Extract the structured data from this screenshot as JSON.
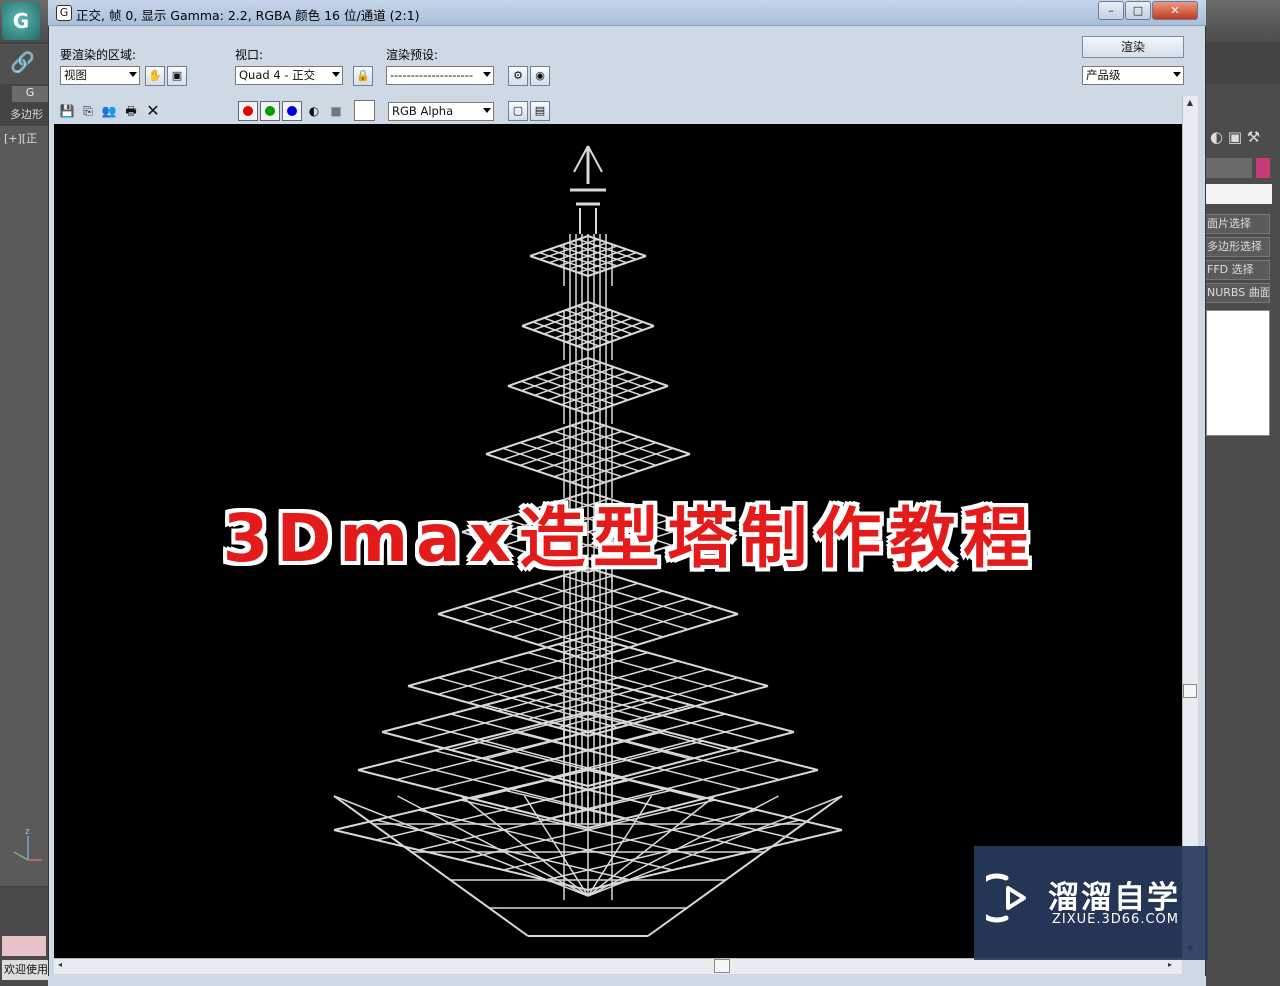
{
  "app": {
    "tab_g": "G",
    "tab_poly": "多边形",
    "viewport_label": "[+][正",
    "welcome": "欢迎使用",
    "axis_label": "z",
    "right_panel_buttons": [
      "面片选择",
      "多边形选择",
      "FFD 选择",
      "NURBS 曲面选择"
    ]
  },
  "window": {
    "title": "正交, 帧 0, 显示 Gamma: 2.2, RGBA 颜色 16 位/通道 (2:1)",
    "minimize": "–",
    "maximize": "□",
    "close": "✕"
  },
  "controls": {
    "area_label": "要渲染的区域:",
    "area_value": "视图",
    "viewport_label": "视口:",
    "viewport_value": "Quad 4 - 正交",
    "preset_label": "渲染预设:",
    "preset_value": "--------------------",
    "render_button": "渲染",
    "quality_value": "产品级",
    "channel_value": "RGB Alpha"
  },
  "channel_colors": {
    "red": "#e00000",
    "green": "#00a000",
    "blue": "#0000e0"
  },
  "overlay": {
    "title": "3Dmax造型塔制作教程",
    "title_color": "#e41b1b"
  },
  "watermark": {
    "name": "溜溜自学",
    "url": "ZIXUE.3D66.COM"
  }
}
